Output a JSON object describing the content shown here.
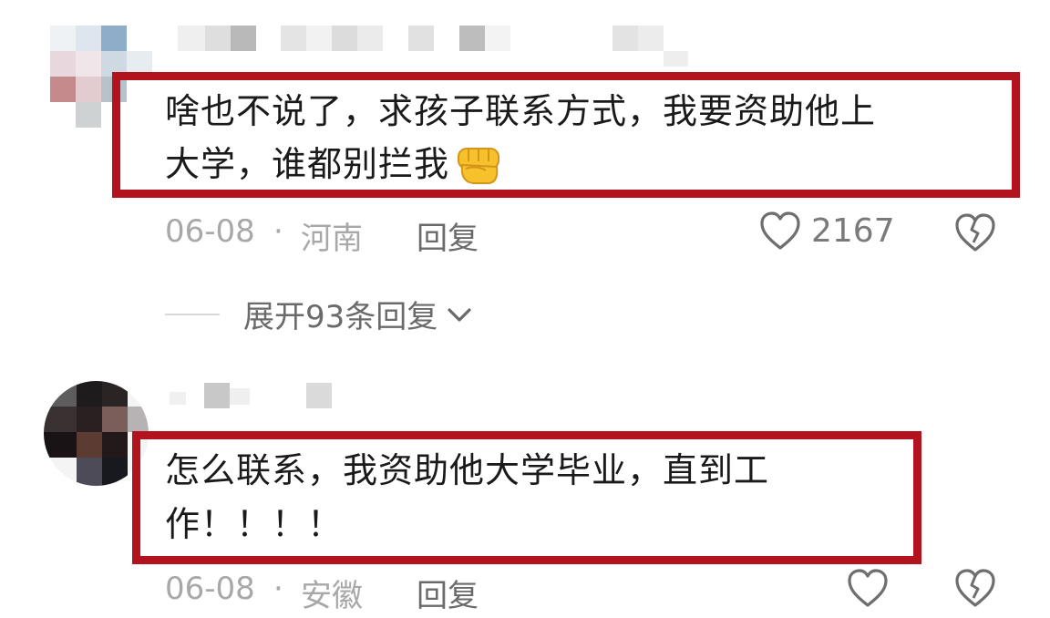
{
  "comments": [
    {
      "text_line1": "啥也不说了，求孩子联系方式，我要资助他上",
      "text_line2": "大学，谁都别拦我",
      "emoji": "fist-emoji",
      "date": "06-08",
      "separator": "·",
      "location": "河南",
      "reply_label": "回复",
      "like_count": "2167",
      "expand_label": "展开93条回复"
    },
    {
      "text_line1": "怎么联系，我资助他大学毕业，直到工",
      "text_line2": "作！！！！",
      "date": "06-08",
      "separator": "·",
      "location": "安徽",
      "reply_label": "回复"
    }
  ],
  "icons": {
    "like": "heart-icon",
    "dislike": "broken-heart-icon",
    "expand": "chevron-down-icon"
  },
  "colors": {
    "highlight": "#b3131c",
    "meta_text": "#a8a8a8",
    "action_text": "#6a6a6a"
  }
}
